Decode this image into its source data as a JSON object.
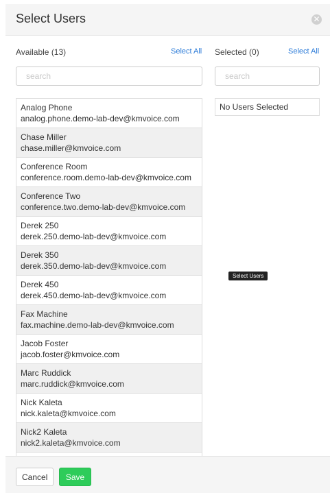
{
  "modal": {
    "title": "Select Users",
    "close_icon": "close-circle-icon"
  },
  "available": {
    "header": "Available (13)",
    "select_all": "Select All",
    "search_placeholder": "search",
    "users": [
      {
        "name": "Analog Phone",
        "email": "analog.phone.demo-lab-dev@kmvoice.com"
      },
      {
        "name": "Chase Miller",
        "email": "chase.miller@kmvoice.com"
      },
      {
        "name": "Conference Room",
        "email": "conference.room.demo-lab-dev@kmvoice.com"
      },
      {
        "name": "Conference Two",
        "email": "conference.two.demo-lab-dev@kmvoice.com"
      },
      {
        "name": "Derek 250",
        "email": "derek.250.demo-lab-dev@kmvoice.com"
      },
      {
        "name": "Derek 350",
        "email": "derek.350.demo-lab-dev@kmvoice.com"
      },
      {
        "name": "Derek 450",
        "email": "derek.450.demo-lab-dev@kmvoice.com"
      },
      {
        "name": "Fax Machine",
        "email": "fax.machine.demo-lab-dev@kmvoice.com"
      },
      {
        "name": "Jacob Foster",
        "email": "jacob.foster@kmvoice.com"
      },
      {
        "name": "Marc Ruddick",
        "email": "marc.ruddick@kmvoice.com"
      },
      {
        "name": "Nick Kaleta",
        "email": "nick.kaleta@kmvoice.com"
      },
      {
        "name": "Nick2 Kaleta",
        "email": "nick2.kaleta@kmvoice.com"
      }
    ]
  },
  "selected": {
    "header": "Selected (0)",
    "select_all": "Select All",
    "search_placeholder": "search",
    "empty_text": "No Users Selected"
  },
  "tooltip": "Select Users",
  "footer": {
    "cancel_label": "Cancel",
    "save_label": "Save"
  },
  "colors": {
    "accent_link": "#2a7ad8",
    "save_button": "#2ecc5a"
  }
}
